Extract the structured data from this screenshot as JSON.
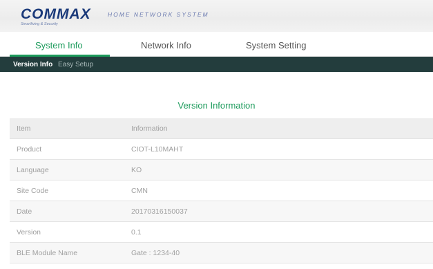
{
  "header": {
    "brand": "COMMAX",
    "brand_tagline": "Smartliving & Security",
    "subtitle": "HOME NETWORK SYSTEM"
  },
  "tabs": [
    {
      "label": "System Info",
      "active": true
    },
    {
      "label": "Network Info",
      "active": false
    },
    {
      "label": "System Setting",
      "active": false
    }
  ],
  "subnav": [
    {
      "label": "Version Info",
      "active": true
    },
    {
      "label": "Easy Setup",
      "active": false
    }
  ],
  "section": {
    "title": "Version Information"
  },
  "table": {
    "headers": [
      "Item",
      "Information"
    ],
    "rows": [
      [
        "Product",
        "CIOT-L10MAHT"
      ],
      [
        "Language",
        "KO"
      ],
      [
        "Site Code",
        "CMN"
      ],
      [
        "Date",
        "20170316150037"
      ],
      [
        "Version",
        "0.1"
      ],
      [
        "BLE Module Name",
        "Gate : 1234-40"
      ]
    ]
  },
  "colors": {
    "accent": "#1d9b5c",
    "subnav_bg": "#233d3d",
    "brand": "#1b3a7a"
  }
}
